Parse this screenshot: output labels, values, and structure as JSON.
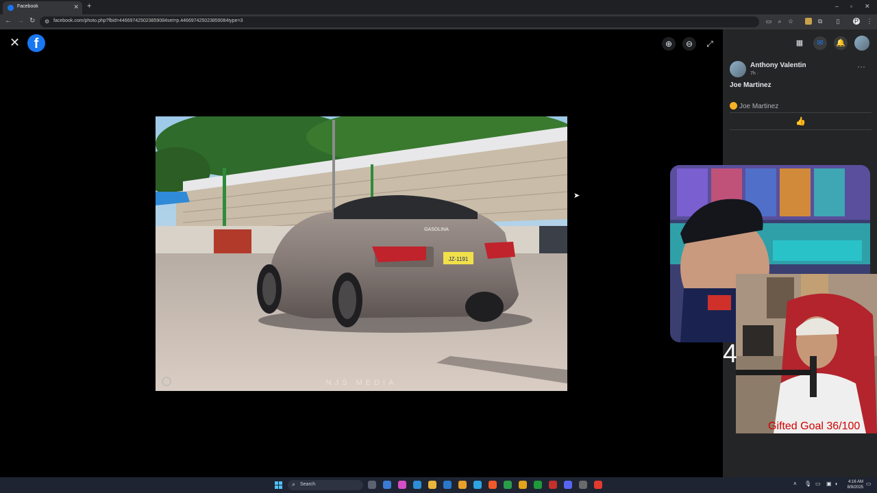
{
  "browser": {
    "tab_title": "Facebook",
    "url": "facebook.com/photo.php?fbid=446697425023859084set=p.446697425023859084type=3",
    "new_tab_label": "+"
  },
  "viewer": {
    "photo_watermark": "NJS MEDIA",
    "license_plate": "JZ-1191",
    "windshield_banner": "GASOLINA"
  },
  "post": {
    "author": "Anthony Valentin",
    "meta": "7h · ",
    "text": "Joe Martinez",
    "reaction_name": "Joe Martinez"
  },
  "overlay": {
    "big_number": "4",
    "goal_text": "Gifted Goal 36/100"
  },
  "taskbar": {
    "search_label": "Search",
    "time": "4:16 AM",
    "date": "8/9/2025"
  },
  "colors": {
    "facebook_blue": "#1877f2",
    "panel_bg": "#242526",
    "goal_red": "#d10000"
  }
}
